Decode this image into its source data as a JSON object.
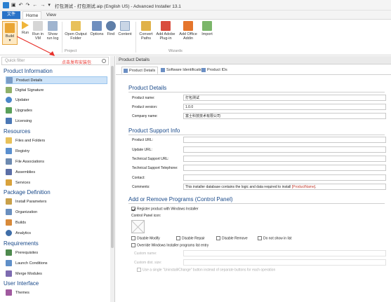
{
  "titlebar": {
    "title": "打包测试 - 打包测试.aip (English US) - Advanced Installer 13.1",
    "quick_access": [
      "save-icon",
      "undo-icon",
      "redo-icon",
      "back-icon",
      "forward-icon"
    ]
  },
  "menu_tabs": {
    "file": "文件",
    "home": "Home",
    "view": "View"
  },
  "ribbon": {
    "build": {
      "label": "Build",
      "sub": "▾"
    },
    "run": "Run",
    "run_in_vm": "Run in VM",
    "show_run_log": "Show run log",
    "open_output_folder": "Open Output Folder",
    "options": "Options",
    "find": "Find",
    "content": "Content",
    "convert_paths": "Convert Paths",
    "add_adobe_plugin": "Add Adobe Plug-in",
    "add_office_addin": "Add Office Addin",
    "import": "Import",
    "group_project": "Project",
    "group_wizards": "Wizards"
  },
  "left": {
    "quick_filter_placeholder": "Quick filter",
    "annotation": "点击发布安装包",
    "sections": [
      {
        "title": "Product Information",
        "items": [
          "Product Details",
          "Digital Signature",
          "Updater",
          "Upgrades",
          "Licensing"
        ]
      },
      {
        "title": "Resources",
        "items": [
          "Files and Folders",
          "Registry",
          "File Associations",
          "Assemblies",
          "Services"
        ]
      },
      {
        "title": "Package Definition",
        "items": [
          "Install Parameters",
          "Organization",
          "Builds",
          "Analytics"
        ]
      },
      {
        "title": "Requirements",
        "items": [
          "Prerequisites",
          "Launch Conditions",
          "Merge Modules"
        ]
      },
      {
        "title": "User Interface",
        "items": [
          "Themes"
        ]
      }
    ]
  },
  "right": {
    "header": "Product Details",
    "tabs": [
      "Product Details",
      "Software Identification",
      "Product IDs"
    ],
    "product_details": {
      "heading": "Product Details",
      "name_label": "Product name:",
      "name_value": "打包测试",
      "version_label": "Product version:",
      "version_value": "1.0.0",
      "company_label": "Company name:",
      "company_value": "富士科技技术有限公司"
    },
    "support": {
      "heading": "Product Support Info",
      "product_url": "Product URL:",
      "update_url": "Update URL:",
      "tech_url": "Technical Support URL:",
      "tech_phone": "Technical Support Telephone:",
      "contact": "Contact:",
      "comments": "Comments:",
      "comments_value": "This installer database contains the logic and data required to install ",
      "comments_token": "[ProductName]",
      "comments_end": "."
    },
    "arp": {
      "heading": "Add or Remove Programs (Control Panel)",
      "register": "Register product with Windows Installer",
      "register_checked": true,
      "control_panel_icon": "Control Panel icon:",
      "disable_modify": "Disable Modify",
      "disable_repair": "Disable Repair",
      "disable_remove": "Disable Remove",
      "do_not_show": "Do not show in list",
      "override": "Override Windows Installer programs list entry",
      "custom_name": "Custom name:",
      "custom_dist_size": "Custom dist. size:",
      "single_button": "Use a single \"Uninstall/Change\" button instead of separate buttons for each operation"
    }
  },
  "colors": {
    "accent": "#2a73c8",
    "section": "#1a4a8a",
    "annotation": "#e8322c",
    "selection": "#cde3f8"
  }
}
